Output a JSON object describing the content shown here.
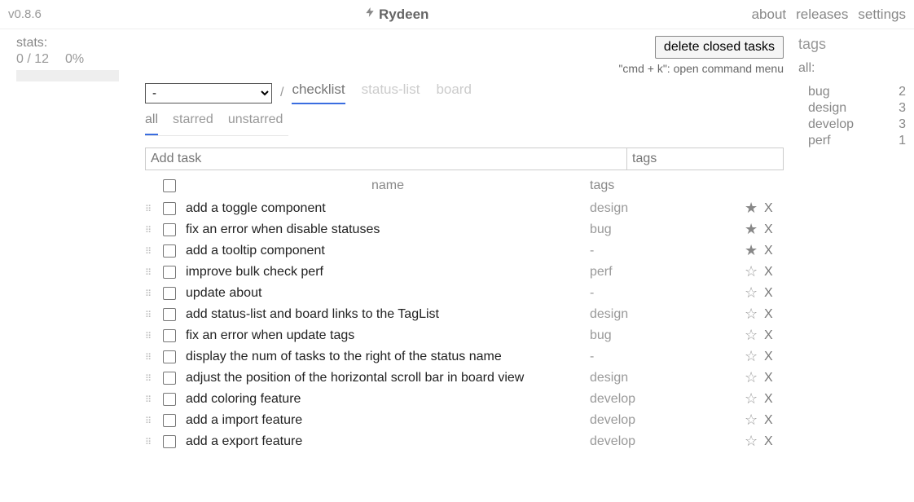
{
  "header": {
    "version": "v0.8.6",
    "brand": "Rydeen",
    "links": {
      "about": "about",
      "releases": "releases",
      "settings": "settings"
    }
  },
  "stats": {
    "label": "stats:",
    "ratio": "0 / 12",
    "pct": "0%"
  },
  "actions": {
    "delete": "delete closed tasks",
    "hint": "\"cmd + k\": open command menu"
  },
  "dropdown_value": "-",
  "view_tabs": {
    "checklist": "checklist",
    "status": "status-list",
    "board": "board"
  },
  "filter_tabs": {
    "all": "all",
    "starred": "starred",
    "unstarred": "unstarred"
  },
  "add": {
    "task_ph": "Add task",
    "tags_ph": "tags"
  },
  "columns": {
    "name": "name",
    "tags": "tags"
  },
  "tasks": [
    {
      "name": "add a toggle component",
      "tags": "design",
      "starred": true
    },
    {
      "name": "fix an error when disable statuses",
      "tags": "bug",
      "starred": true
    },
    {
      "name": "add a tooltip component",
      "tags": "-",
      "starred": true
    },
    {
      "name": "improve bulk check perf",
      "tags": "perf",
      "starred": false
    },
    {
      "name": "update about",
      "tags": "-",
      "starred": false
    },
    {
      "name": "add status-list and board links to the TagList",
      "tags": "design",
      "starred": false
    },
    {
      "name": "fix an error when update tags",
      "tags": "bug",
      "starred": false
    },
    {
      "name": "display the num of tasks to the right of the status name",
      "tags": "-",
      "starred": false
    },
    {
      "name": "adjust the position of the horizontal scroll bar in board view",
      "tags": "design",
      "starred": false
    },
    {
      "name": "add coloring feature",
      "tags": "develop",
      "starred": false
    },
    {
      "name": "add a import feature",
      "tags": "develop",
      "starred": false
    },
    {
      "name": "add a export feature",
      "tags": "develop",
      "starred": false
    }
  ],
  "tags_panel": {
    "title": "tags",
    "all": "all:",
    "items": [
      {
        "name": "bug",
        "count": "2"
      },
      {
        "name": "design",
        "count": "3"
      },
      {
        "name": "develop",
        "count": "3"
      },
      {
        "name": "perf",
        "count": "1"
      }
    ]
  },
  "del_glyph": "X"
}
